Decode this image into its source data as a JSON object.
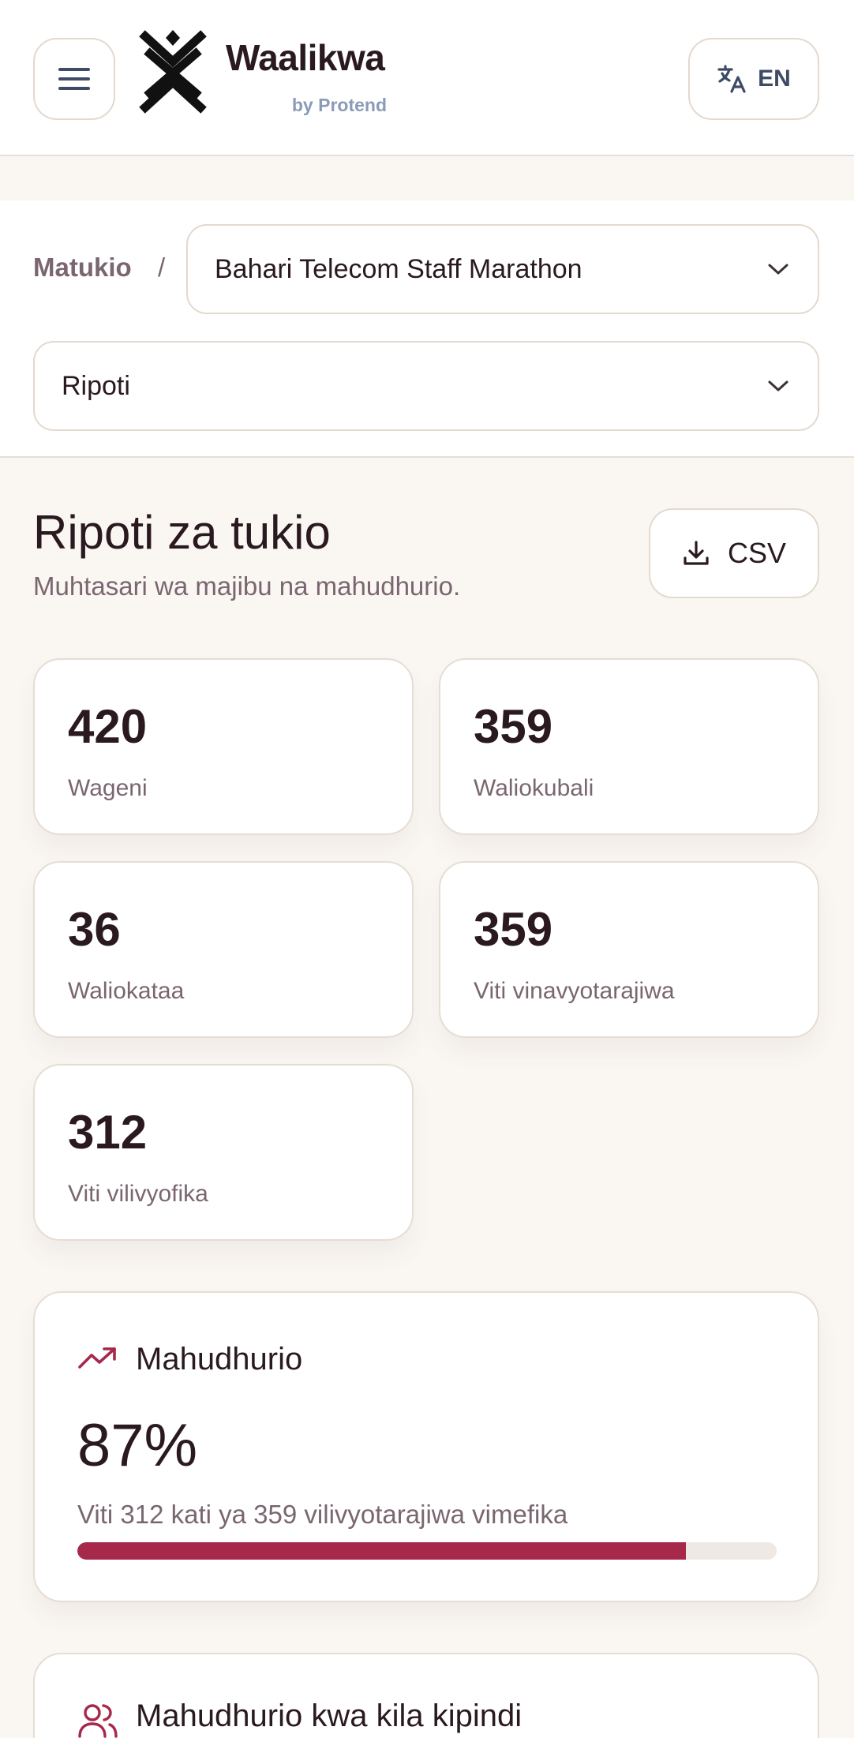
{
  "header": {
    "brand_name": "Waalikwa",
    "brand_sub": "by Protend",
    "language": "EN",
    "menu_icon": "hamburger-icon",
    "language_icon": "translate-icon"
  },
  "breadcrumb": {
    "root": "Matukio",
    "separator": "/",
    "event_selected": "Bahari Telecom Staff Marathon",
    "section_selected": "Ripoti"
  },
  "page": {
    "title": "Ripoti za tukio",
    "subtitle": "Muhtasari wa majibu na mahudhurio.",
    "csv_label": "CSV"
  },
  "stats": [
    {
      "value": "420",
      "label": "Wageni"
    },
    {
      "value": "359",
      "label": "Waliokubali"
    },
    {
      "value": "36",
      "label": "Waliokataa"
    },
    {
      "value": "359",
      "label": "Viti vinavyotarajiwa"
    },
    {
      "value": "312",
      "label": "Viti vilivyofika"
    }
  ],
  "attendance": {
    "title": "Mahudhurio",
    "percent": "87%",
    "description": "Viti 312 kati ya 359 vilivyotarajiwa vimefika",
    "progress_fraction": 0.87
  },
  "session_attendance": {
    "title": "Mahudhurio kwa kila kipindi"
  },
  "colors": {
    "accent": "#a6284b",
    "background": "#faf7f3",
    "text": "#2a1a20",
    "muted": "#7a6670",
    "border": "#e3d9cf"
  }
}
